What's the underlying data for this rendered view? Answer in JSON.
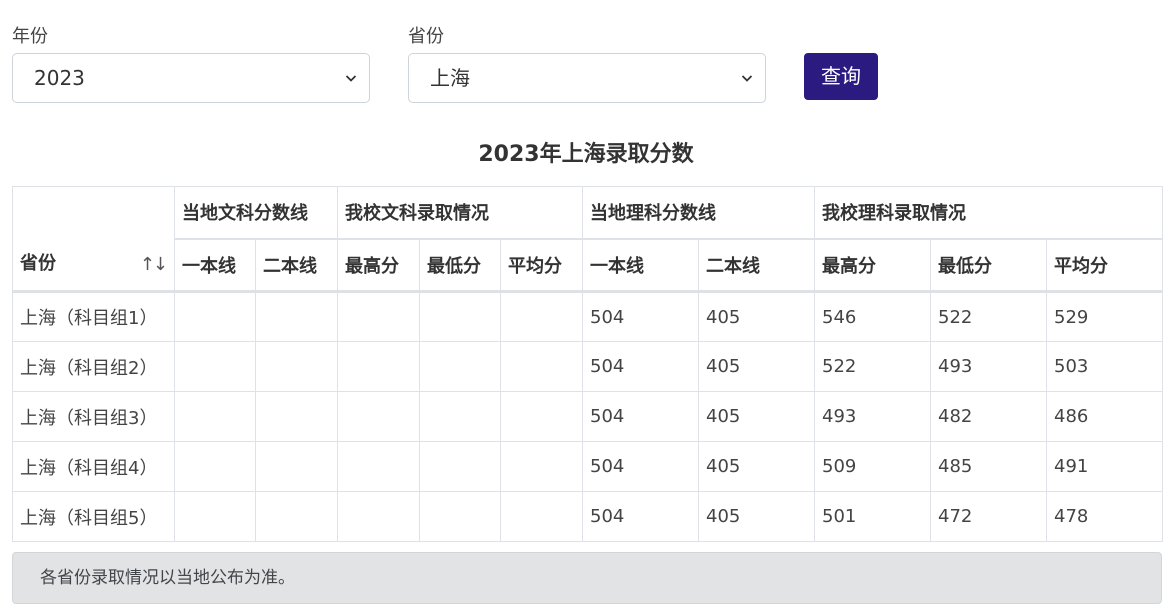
{
  "filters": {
    "year": {
      "label": "年份",
      "value": "2023"
    },
    "province": {
      "label": "省份",
      "value": "上海"
    },
    "query_label": "查询"
  },
  "table_title": "2023年上海录取分数",
  "table": {
    "province_header": "省份",
    "sort_glyph": "↑↓",
    "groups": [
      "当地文科分数线",
      "我校文科录取情况",
      "当地理科分数线",
      "我校理科录取情况"
    ],
    "sub": {
      "line1": "一本线",
      "line2": "二本线",
      "max": "最高分",
      "min": "最低分",
      "avg": "平均分"
    },
    "rows": [
      {
        "province": "上海（科目组1）",
        "arts": [
          "",
          "",
          "",
          "",
          ""
        ],
        "sci": [
          "504",
          "405",
          "546",
          "522",
          "529"
        ]
      },
      {
        "province": "上海（科目组2）",
        "arts": [
          "",
          "",
          "",
          "",
          ""
        ],
        "sci": [
          "504",
          "405",
          "522",
          "493",
          "503"
        ]
      },
      {
        "province": "上海（科目组3）",
        "arts": [
          "",
          "",
          "",
          "",
          ""
        ],
        "sci": [
          "504",
          "405",
          "493",
          "482",
          "486"
        ]
      },
      {
        "province": "上海（科目组4）",
        "arts": [
          "",
          "",
          "",
          "",
          ""
        ],
        "sci": [
          "504",
          "405",
          "509",
          "485",
          "491"
        ]
      },
      {
        "province": "上海（科目组5）",
        "arts": [
          "",
          "",
          "",
          "",
          ""
        ],
        "sci": [
          "504",
          "405",
          "501",
          "472",
          "478"
        ]
      }
    ]
  },
  "note": "各省份录取情况以当地公布为准。",
  "colors": {
    "button": "#2b1a80",
    "note_bg": "#e2e3e5",
    "border": "#dee2e6"
  }
}
